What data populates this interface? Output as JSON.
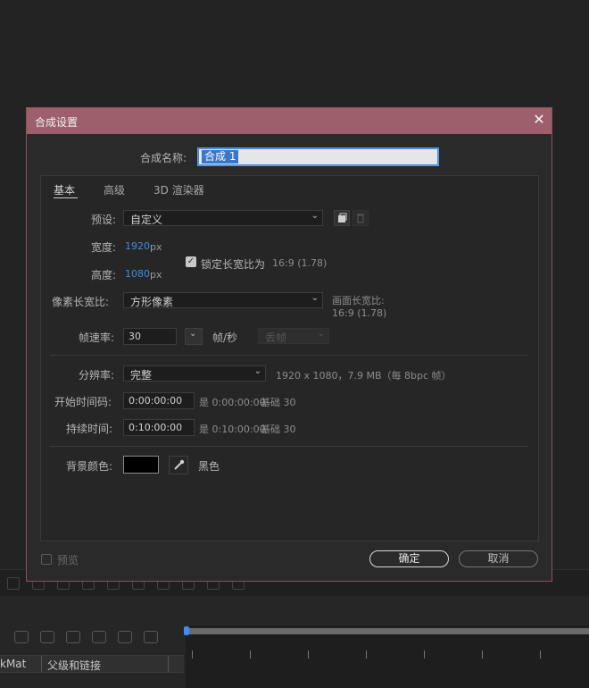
{
  "dialog": {
    "title": "合成设置",
    "close_glyph": "✕",
    "comp_name_label": "合成名称:",
    "comp_name_value": "合成 1",
    "tabs": [
      {
        "label": "基本",
        "active": true
      },
      {
        "label": "高级",
        "active": false
      },
      {
        "label": "3D 渲染器",
        "active": false
      }
    ],
    "preset_label": "预设:",
    "preset_value": "自定义",
    "width_label": "宽度:",
    "width_value": "1920",
    "width_unit": "px",
    "height_label": "高度:",
    "height_value": "1080",
    "height_unit": "px",
    "lock_aspect_label": "锁定长宽比为",
    "lock_aspect_value": "16:9 (1.78)",
    "lock_aspect_checked": true,
    "pixel_aspect_label": "像素长宽比:",
    "pixel_aspect_value": "方形像素",
    "frame_aspect_label": "画面长宽比:",
    "frame_aspect_value": "16:9 (1.78)",
    "frame_rate_label": "帧速率:",
    "frame_rate_value": "30",
    "frame_rate_unit": "帧/秒",
    "drop_frame_value": "丢帧",
    "resolution_label": "分辨率:",
    "resolution_value": "完整",
    "resolution_info": "1920 x 1080，7.9 MB（每 8bpc 帧）",
    "start_timecode_label": "开始时间码:",
    "start_timecode_value": "0:00:00:00",
    "start_timecode_note": "是 0:00:00:00",
    "start_timecode_base": "基础 30",
    "duration_label": "持续时间:",
    "duration_value": "0:10:00:00",
    "duration_note": "是 0:10:00:00",
    "duration_base": "基础 30",
    "bg_color_label": "背景颜色:",
    "bg_color_name": "黑色",
    "bg_color_hex": "#000000",
    "preview_label": "预览",
    "preview_checked": false,
    "ok_label": "确定",
    "cancel_label": "取消"
  },
  "timeline": {
    "column_trkmat": "kMat",
    "column_parent": "父级和链接"
  },
  "colors": {
    "titlebar": "#9c5f6b",
    "accent_blue": "#3f8de0",
    "background": "#232323"
  }
}
